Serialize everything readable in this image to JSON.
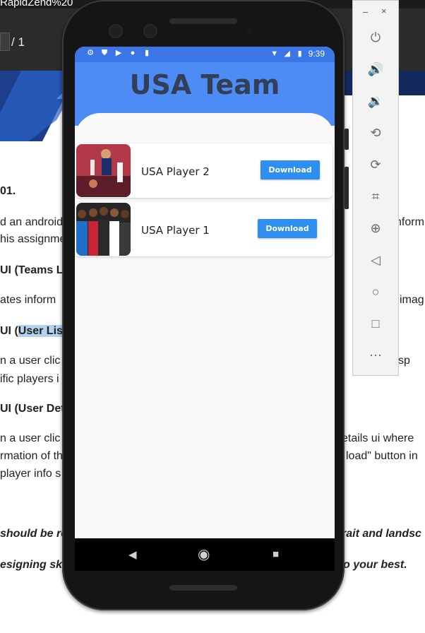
{
  "doc": {
    "title_fragment": "RapidZend%20",
    "page_current": "",
    "page_separator": "/",
    "page_total": "1",
    "lines": [
      "01.",
      "d an android",
      "nform",
      "his assignme",
      "UI (Teams Lis",
      "ates inform",
      "imag",
      "UI (",
      "User List",
      "n a user clic",
      "ll disp",
      "ific players i",
      "UI (User Det",
      "n a user clic",
      "etails ui where",
      "rmation of th",
      "load\" button in",
      "player info s",
      "should be re",
      "rait and landsc",
      "esigning ski",
      "o your best."
    ]
  },
  "app": {
    "status_time": "9:39",
    "title": "USA Team",
    "players": [
      {
        "name": "USA Player 2",
        "button": "Download"
      },
      {
        "name": "USA Player 1",
        "button": "Download"
      }
    ],
    "colors": {
      "header": "#4d8cf5",
      "status": "#3b75e6",
      "button": "#2e8ff0",
      "title": "#333f56"
    }
  },
  "emulator": {
    "min": "–",
    "close": "×",
    "icons": [
      "power-icon",
      "volume-up-icon",
      "volume-down-icon",
      "rotate-left-icon",
      "rotate-right-icon",
      "camera-icon",
      "zoom-icon",
      "back-icon",
      "home-icon",
      "overview-icon",
      "more-icon"
    ]
  }
}
